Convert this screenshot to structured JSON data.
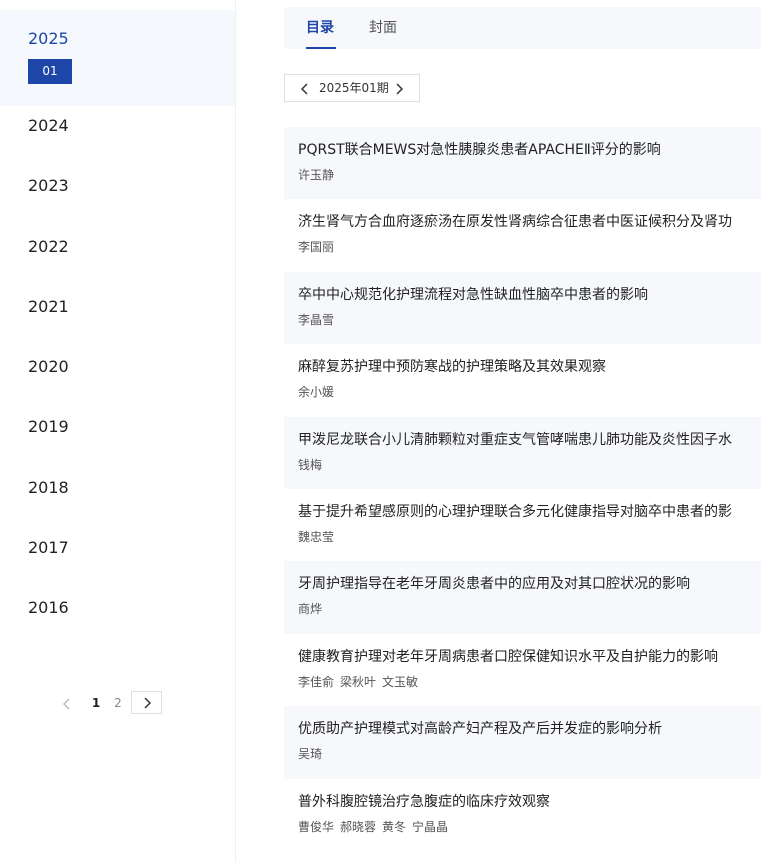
{
  "sidebar": {
    "active_year": "2025",
    "active_issue": "01",
    "years": [
      "2024",
      "2023",
      "2022",
      "2021",
      "2020",
      "2019",
      "2018",
      "2017",
      "2016"
    ],
    "pager": {
      "pages": [
        "1",
        "2"
      ],
      "current": "1"
    }
  },
  "tabs": [
    {
      "label": "目录",
      "active": true
    },
    {
      "label": "封面",
      "active": false
    }
  ],
  "issue_selector": {
    "current": "2025年01期"
  },
  "articles": [
    {
      "title": "PQRST联合MEWS对急性胰腺炎患者APACHEⅡ评分的影响",
      "authors": [
        "许玉静"
      ]
    },
    {
      "title": "济生肾气方合血府逐瘀汤在原发性肾病综合征患者中医证候积分及肾功",
      "authors": [
        "李国丽"
      ]
    },
    {
      "title": "卒中中心规范化护理流程对急性缺血性脑卒中患者的影响",
      "authors": [
        "李晶雪"
      ]
    },
    {
      "title": "麻醉复苏护理中预防寒战的护理策略及其效果观察",
      "authors": [
        "余小媛"
      ]
    },
    {
      "title": "甲泼尼龙联合小儿清肺颗粒对重症支气管哮喘患儿肺功能及炎性因子水",
      "authors": [
        "钱梅"
      ]
    },
    {
      "title": "基于提升希望感原则的心理护理联合多元化健康指导对脑卒中患者的影",
      "authors": [
        "魏忠莹"
      ]
    },
    {
      "title": "牙周护理指导在老年牙周炎患者中的应用及对其口腔状况的影响",
      "authors": [
        "商烨"
      ]
    },
    {
      "title": "健康教育护理对老年牙周病患者口腔保健知识水平及自护能力的影响",
      "authors": [
        "李佳俞",
        "梁秋叶",
        "文玉敏"
      ]
    },
    {
      "title": "优质助产护理模式对高龄产妇产程及产后并发症的影响分析",
      "authors": [
        "吴琦"
      ]
    },
    {
      "title": "普外科腹腔镜治疗急腹症的临床疗效观察",
      "authors": [
        "曹俊华",
        "郝晓蓉",
        "黄冬",
        "宁晶晶"
      ]
    }
  ],
  "colors": {
    "accent": "#1e46a8",
    "shade": "#f6f8fb"
  }
}
